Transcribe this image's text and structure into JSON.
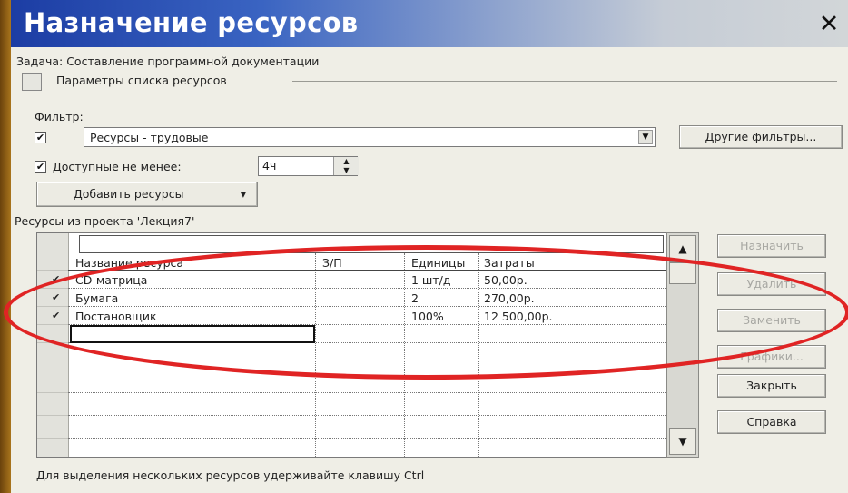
{
  "window": {
    "title": "Назначение ресурсов",
    "close_glyph": "✕"
  },
  "task": {
    "label": "Задача: Составление программной документации"
  },
  "options_group": {
    "label": "Параметры списка ресурсов"
  },
  "filter": {
    "label": "Фильтр:",
    "checked_mark": "✔",
    "value": "Ресурсы - трудовые",
    "other_filters_label": "Другие фильтры..."
  },
  "availability": {
    "checked_mark": "✔",
    "label": "Доступные не менее:",
    "value": "4ч"
  },
  "add_resources": {
    "label": "Добавить ресурсы",
    "arrow": "▾"
  },
  "resources_group": {
    "label": "Ресурсы из проекта 'Лекция7'"
  },
  "table": {
    "columns": [
      "Название ресурса",
      "З/П",
      "Единицы",
      "Затраты"
    ],
    "rows": [
      {
        "check": "✔",
        "name": "CD-матрица",
        "rate": "",
        "units": "1 шт/д",
        "cost": "50,00р."
      },
      {
        "check": "✔",
        "name": "Бумага",
        "rate": "",
        "units": "2",
        "cost": "270,00р."
      },
      {
        "check": "✔",
        "name": "Постановщик",
        "rate": "",
        "units": "100%",
        "cost": "12 500,00р."
      }
    ]
  },
  "scrollbar": {
    "up_arrow": "▲",
    "down_arrow": "▼"
  },
  "side_buttons": {
    "assign": "Назначить",
    "remove": "Удалить",
    "replace": "Заменить",
    "graphs": "Графики...",
    "close": "Закрыть",
    "help": "Справка"
  },
  "footer": {
    "hint": "Для выделения нескольких ресурсов удерживайте клавишу Ctrl"
  },
  "colors": {
    "titlebar_start": "#1c3da4",
    "titlebar_end": "#d2d6d8",
    "dialog_bg": "#efeee6",
    "annotation_red": "#e02424",
    "outer_frame": "#8a5a12"
  }
}
